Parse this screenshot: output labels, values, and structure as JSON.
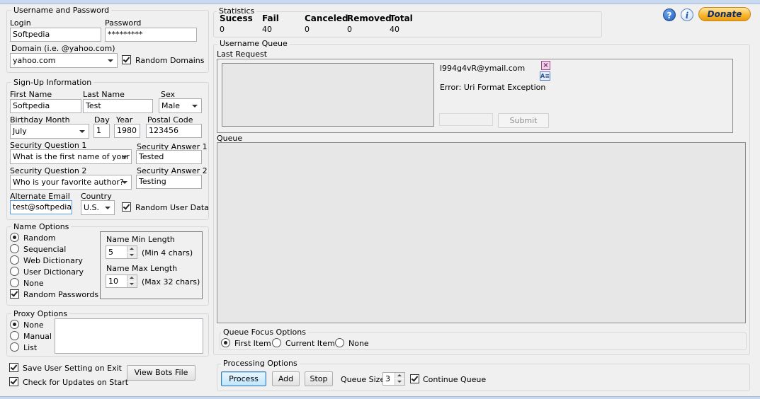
{
  "credentials": {
    "title": "Username and Password",
    "login_label": "Login",
    "login_value": "Softpedia",
    "password_label": "Password",
    "password_value": "*********",
    "domain_label": "Domain (i.e. @yahoo.com)",
    "domain_value": "yahoo.com",
    "random_domains_label": "Random Domains"
  },
  "signup": {
    "title": "Sign-Up Information",
    "first_name_label": "First Name",
    "first_name_value": "Softpedia",
    "last_name_label": "Last Name",
    "last_name_value": "Test",
    "sex_label": "Sex",
    "sex_value": "Male",
    "birth_month_label": "Birthday Month",
    "birth_month_value": "July",
    "day_label": "Day",
    "day_value": "1",
    "year_label": "Year",
    "year_value": "1980",
    "postal_label": "Postal Code",
    "postal_value": "123456",
    "sq1_label": "Security Question 1",
    "sq1_value": "What is the first name of your fa",
    "sa1_label": "Security Answer 1",
    "sa1_value": "Tested",
    "sq2_label": "Security Question 2",
    "sq2_value": "Who is your favorite author?",
    "sa2_label": "Security Answer 2",
    "sa2_value": "Testing",
    "alt_email_label": "Alternate Email",
    "alt_email_value": "test@softpedia.co",
    "country_label": "Country",
    "country_value": "U.S.",
    "random_user_data_label": "Random User Data"
  },
  "name_options": {
    "title": "Name Options",
    "random": "Random",
    "sequencial": "Sequencial",
    "web_dictionary": "Web Dictionary",
    "user_dictionary": "User Dictionary",
    "none": "None",
    "random_passwords": "Random Passwords",
    "min_length_label": "Name Min Length",
    "min_length_value": "5",
    "min_hint": "(Min 4 chars)",
    "max_length_label": "Name Max Length",
    "max_length_value": "10",
    "max_hint": "(Max 32 chars)"
  },
  "proxy": {
    "title": "Proxy Options",
    "none": "None",
    "manual": "Manual",
    "list": "List"
  },
  "settings": {
    "save_setting_label": "Save User Setting on Exit",
    "check_updates_label": "Check for Updates on Start",
    "view_bots_label": "View Bots File"
  },
  "statistics": {
    "title": "Statistics",
    "columns": [
      {
        "label": "Sucess",
        "value": "0"
      },
      {
        "label": "Fail",
        "value": "40"
      },
      {
        "label": "Canceled",
        "value": "0"
      },
      {
        "label": "Removed",
        "value": "0"
      },
      {
        "label": "Total",
        "value": "40"
      }
    ]
  },
  "queue_section": {
    "title": "Username Queue",
    "last_request_label": "Last Request",
    "last_email": "l994g4vR@ymail.com",
    "last_error": "Error: Uri Format Exception",
    "submit_label": "Submit",
    "queue_label": "Queue"
  },
  "focus_options": {
    "title": "Queue Focus Options",
    "first_item": "First Item",
    "current_item": "Current Item",
    "none": "None"
  },
  "processing": {
    "title": "Processing Options",
    "process_label": "Process",
    "add_label": "Add",
    "stop_label": "Stop",
    "queue_size_label": "Queue Size",
    "queue_size_value": "3",
    "continue_queue_label": "Continue Queue"
  },
  "header": {
    "donate_label": "Donate",
    "help_glyph": "?",
    "info_glyph": "i"
  },
  "colors": {
    "background": "#f0f0f0",
    "donate": "#f7b52b",
    "help": "#2b6cc4"
  }
}
